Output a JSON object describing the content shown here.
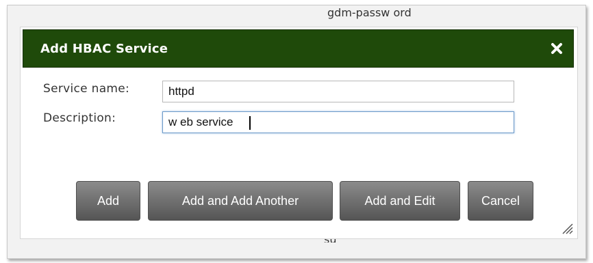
{
  "background": {
    "top_item": "gdm-passw ord",
    "bottom_item": "su"
  },
  "dialog": {
    "title": "Add HBAC Service",
    "close_icon": "close-icon",
    "title_bar_color": "#1f4a0a"
  },
  "form": {
    "service_name_label": "Service name:",
    "service_name_value": "httpd",
    "description_label": "Description:",
    "description_value": "w eb service"
  },
  "buttons": {
    "add": "Add",
    "add_and_add_another": "Add and Add Another",
    "add_and_edit": "Add and Edit",
    "cancel": "Cancel"
  },
  "resize_icon": "resize-grip-icon"
}
